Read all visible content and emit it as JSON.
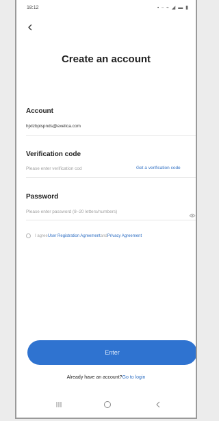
{
  "status": {
    "time": "18:12",
    "icons": "▪ ▫ ⌁ ◢ ▬ ▮"
  },
  "header": {
    "title": "Create an account"
  },
  "account": {
    "label": "Account",
    "value": "hjxlzbpispnds@exelica.com"
  },
  "verification": {
    "label": "Verification code",
    "placeholder": "Please enter verification cod",
    "get_code": "Get a verification code"
  },
  "password": {
    "label": "Password",
    "placeholder": "Please enter password (8–20 letters/numbers)"
  },
  "agreement": {
    "prefix": "I agree",
    "link1": "User Registration Agreement",
    "and": "and",
    "link2": "Privacy Agreement"
  },
  "enter_button": "Enter",
  "login": {
    "question": "Already have an account?",
    "link": "Go to login"
  },
  "colors": {
    "primary": "#2f73d0",
    "link": "#2f6fc3"
  },
  "icons": [
    "back-arrow-icon",
    "eye-icon",
    "recent-apps-icon",
    "home-icon",
    "nav-back-icon"
  ]
}
